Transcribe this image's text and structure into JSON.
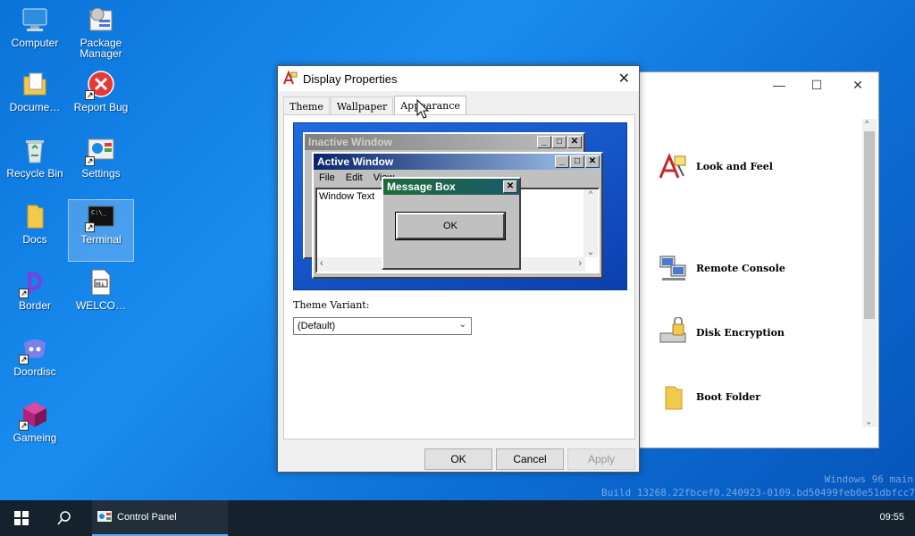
{
  "desktop": {
    "icons": [
      {
        "label": "Computer"
      },
      {
        "label": "Package Manager"
      },
      {
        "label": "Docume…"
      },
      {
        "label": "Report Bug"
      },
      {
        "label": "Recycle Bin"
      },
      {
        "label": "Settings"
      },
      {
        "label": "Docs"
      },
      {
        "label": "Terminal"
      },
      {
        "label": "Border"
      },
      {
        "label": "WELCO…"
      },
      {
        "label": "Doordisc"
      },
      {
        "label": "Gameing"
      }
    ]
  },
  "control_panel": {
    "items": [
      {
        "label": "Look and Feel"
      },
      {
        "label": "Remote Console"
      },
      {
        "label": "Disk Encryption"
      },
      {
        "label": "Boot Folder"
      }
    ]
  },
  "dialog": {
    "title": "Display Properties",
    "tabs": [
      "Theme",
      "Wallpaper",
      "Appearance"
    ],
    "active_tab": "Appearance",
    "preview": {
      "inactive_title": "Inactive Window",
      "active_title": "Active Window",
      "menu": [
        "File",
        "Edit",
        "View"
      ],
      "window_text": "Window Text",
      "msgbox_title": "Message Box",
      "msgbox_ok": "OK"
    },
    "theme_variant_label": "Theme Variant:",
    "theme_variant_value": "(Default)",
    "buttons": {
      "ok": "OK",
      "cancel": "Cancel",
      "apply": "Apply"
    }
  },
  "watermark": {
    "line1": "Windows 96 main",
    "line2": "Build 13268.22fbcef0.240923-0109.bd50499feb0e51dbfcc7"
  },
  "taskbar": {
    "task_label": "Control Panel",
    "clock": "09:55"
  },
  "colors": {
    "accent": "#5aa7ff",
    "active_title_start": "#0a246a",
    "active_title_end": "#a6caf0",
    "msgbox_title_start": "#1f6b3a",
    "msgbox_title_end": "#1a5a6a"
  }
}
